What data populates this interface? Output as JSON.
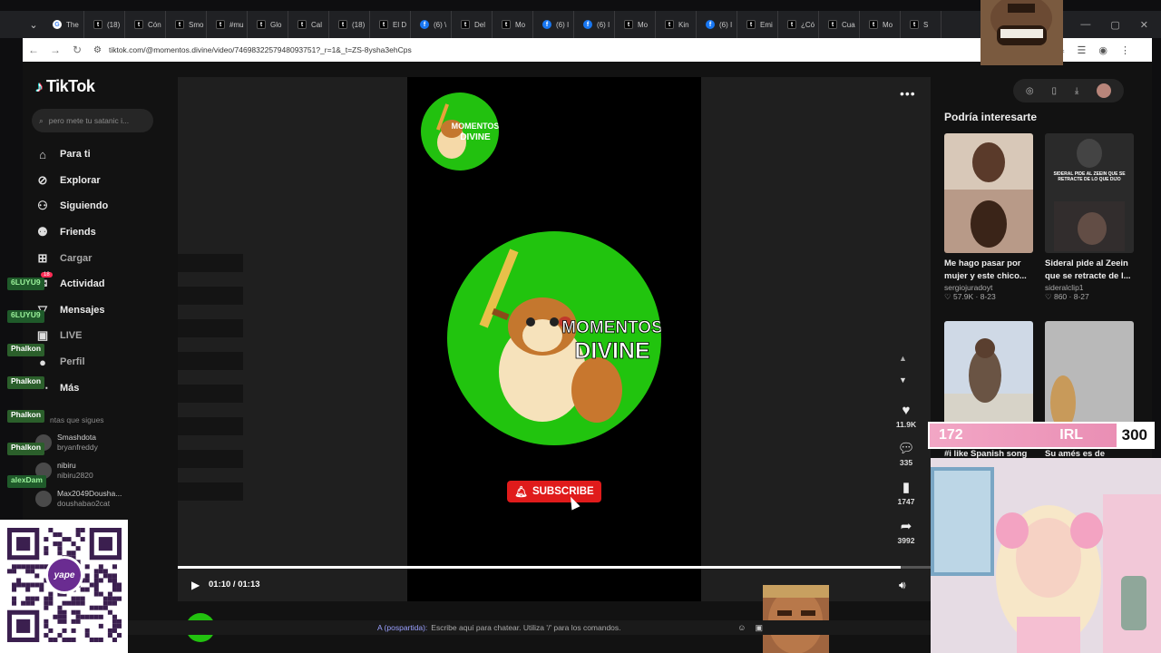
{
  "browser": {
    "tabs": [
      {
        "icon": "G",
        "type": "g",
        "label": "The"
      },
      {
        "icon": "t",
        "type": "t",
        "label": "(18)"
      },
      {
        "icon": "t",
        "type": "t",
        "label": "Cón"
      },
      {
        "icon": "t",
        "type": "t",
        "label": "Smo"
      },
      {
        "icon": "t",
        "type": "t",
        "label": "#mu"
      },
      {
        "icon": "t",
        "type": "t",
        "label": "Glo"
      },
      {
        "icon": "t",
        "type": "t",
        "label": "Cal"
      },
      {
        "icon": "t",
        "type": "t",
        "label": "(18)"
      },
      {
        "icon": "t",
        "type": "t",
        "label": "El D"
      },
      {
        "icon": "f",
        "type": "f",
        "label": "(6) \\"
      },
      {
        "icon": "t",
        "type": "t",
        "label": "Del"
      },
      {
        "icon": "t",
        "type": "t",
        "label": "Mo"
      },
      {
        "icon": "f",
        "type": "f",
        "label": "(6) I"
      },
      {
        "icon": "f",
        "type": "f",
        "label": "(6) I"
      },
      {
        "icon": "t",
        "type": "t",
        "label": "Mo"
      },
      {
        "icon": "t",
        "type": "t",
        "label": "Kin"
      },
      {
        "icon": "f",
        "type": "f",
        "label": "(6) I"
      },
      {
        "icon": "t",
        "type": "t",
        "label": "Emi"
      },
      {
        "icon": "t",
        "type": "t",
        "label": "¿Có"
      },
      {
        "icon": "t",
        "type": "t",
        "label": "Cua"
      },
      {
        "icon": "t",
        "type": "t",
        "label": "Mo"
      },
      {
        "icon": "t",
        "type": "t",
        "label": "S"
      }
    ],
    "url": "tiktok.com/@momentos.divine/video/7469832257948093751?_r=1&_t=ZS-8ysha3ehCps"
  },
  "tiktok": {
    "logo_text": "TikTok",
    "search_placeholder": "pero mete tu satanic i...",
    "nav": [
      {
        "icon": "⌂",
        "label": "Para ti",
        "dim": false
      },
      {
        "icon": "⊘",
        "label": "Explorar",
        "dim": false
      },
      {
        "icon": "⚇",
        "label": "Siguiendo",
        "dim": false
      },
      {
        "icon": "⚉",
        "label": "Friends",
        "dim": false
      },
      {
        "icon": "⊞",
        "label": "Cargar",
        "dim": true
      },
      {
        "icon": "✉",
        "label": "Actividad",
        "dim": false
      },
      {
        "icon": "▽",
        "label": "Mensajes",
        "dim": false
      },
      {
        "icon": "▣",
        "label": "LIVE",
        "dim": true
      },
      {
        "icon": "●",
        "label": "Perfil",
        "dim": true
      },
      {
        "icon": "⋯",
        "label": "Más",
        "dim": false
      }
    ],
    "notification_badge": "18",
    "following_header": "ntas que sigues",
    "following": [
      {
        "name": "Smashdota",
        "handle": "bryanfreddy"
      },
      {
        "name": "nibiru",
        "handle": "nibiru2820"
      },
      {
        "name": "Max2049Dousha...",
        "handle": "doushabao2cat"
      }
    ],
    "video": {
      "logo_line1": "MOMENTOS",
      "logo_line2": "DIVINE",
      "subscribe_label": "SUBSCRIBE",
      "progress": 0.96,
      "time": "01:10 / 01:13",
      "likes": "11.9K",
      "comments": "335",
      "saves": "1747",
      "shares": "3992",
      "author": "momentos_divine"
    },
    "recommended": {
      "title": "Podría interesarte",
      "items": [
        {
          "caption": "Me hago pasar por",
          "caption2": "mujer y este chico...",
          "author": "sergiojuradoyt",
          "stats": "♡ 57.9K · 8-23"
        },
        {
          "caption": "Sideral pide al Zeein",
          "caption2": "que se retracte de l...",
          "author": "sideralclip1",
          "stats": "♡ 860 · 8-27",
          "overlay": "SIDERAL PIDE AL ZEEIN QUE SE RETRACTE DE LO QUE DIJO"
        },
        {
          "caption": "#i like Spanish song",
          "author": ""
        },
        {
          "caption": "Su amés es de",
          "author": ""
        }
      ]
    }
  },
  "stream": {
    "chat_users": [
      {
        "name": "6LUYU9",
        "style": "c1"
      },
      {
        "name": "6LUYU9",
        "style": "c1"
      },
      {
        "name": "Phalkon",
        "style": "c2"
      },
      {
        "name": "Phalkon",
        "style": "c2"
      },
      {
        "name": "Phalkon",
        "style": "c2"
      },
      {
        "name": "Phalkon",
        "style": "c2"
      },
      {
        "name": "alexDam",
        "style": "c1"
      }
    ],
    "qr_brand": "yape",
    "irl_left": "172",
    "irl_label": "IRL",
    "irl_right": "300",
    "chat_prefix": "A (pospartida):",
    "chat_placeholder": "Escribe aquí para chatear. Utiliza '/' para los comandos."
  }
}
